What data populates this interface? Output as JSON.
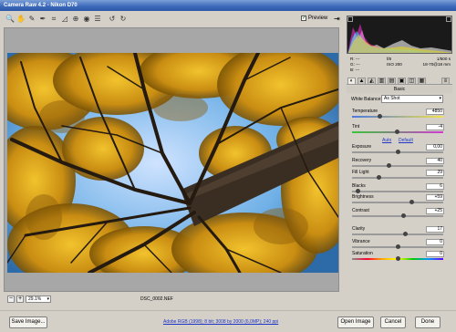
{
  "window": {
    "title": "Camera Raw 4.2  -  Nikon D70"
  },
  "toolbar": {
    "tools": [
      {
        "name": "zoom-tool-icon",
        "glyph": "🔍"
      },
      {
        "name": "hand-tool-icon",
        "glyph": "✋"
      },
      {
        "name": "white-balance-tool-icon",
        "glyph": "✎"
      },
      {
        "name": "color-sampler-tool-icon",
        "glyph": "✒"
      },
      {
        "name": "crop-tool-icon",
        "glyph": "⌗"
      },
      {
        "name": "straighten-tool-icon",
        "glyph": "◿"
      },
      {
        "name": "retouch-tool-icon",
        "glyph": "⊕"
      },
      {
        "name": "red-eye-tool-icon",
        "glyph": "◉"
      },
      {
        "name": "preferences-icon",
        "glyph": "☰"
      },
      {
        "name": "rotate-left-icon",
        "glyph": "↺"
      },
      {
        "name": "rotate-right-icon",
        "glyph": "↻"
      }
    ],
    "preview_label": "Preview",
    "preview_checked": true
  },
  "status": {
    "zoom": "29.1%",
    "filename": "DSC_0002.NEF"
  },
  "camera_info": {
    "r_label": "R:",
    "g_label": "G:",
    "b_label": "B:",
    "r": "---",
    "g": "---",
    "b": "---",
    "aperture": "f/8",
    "shutter": "1/500 s",
    "iso": "ISO 200",
    "lens": "18-70@18 mm"
  },
  "panel": {
    "title": "Basic",
    "white_balance_label": "White Balance:",
    "white_balance_value": "As Shot",
    "auto_label": "Auto",
    "default_label": "Default",
    "sliders": [
      {
        "label": "Temperature",
        "value": "4850",
        "fraction": 0.3
      },
      {
        "label": "Tint",
        "value": "-4",
        "fraction": 0.49
      },
      {
        "label": "Exposure",
        "value": "0,00",
        "fraction": 0.5
      },
      {
        "label": "Recovery",
        "value": "40",
        "fraction": 0.4
      },
      {
        "label": "Fill Light",
        "value": "29",
        "fraction": 0.29
      },
      {
        "label": "Blacks",
        "value": "6",
        "fraction": 0.06
      },
      {
        "label": "Brightness",
        "value": "+59",
        "fraction": 0.65
      },
      {
        "label": "Contrast",
        "value": "+25",
        "fraction": 0.56
      },
      {
        "label": "Clarity",
        "value": "17",
        "fraction": 0.58
      },
      {
        "label": "Vibrance",
        "value": "0",
        "fraction": 0.5
      },
      {
        "label": "Saturation",
        "value": "0",
        "fraction": 0.5
      }
    ]
  },
  "bottom": {
    "save_label": "Save Image...",
    "profile_link": "Adobe RGB (1998); 8 bit; 3008 by 2000 (6,0MP); 240 ppi",
    "open_label": "Open Image",
    "cancel_label": "Cancel",
    "done_label": "Done"
  },
  "colors": {
    "accent_link": "#1f35c8",
    "canvas_bg": "#a7a7a7",
    "panel_bg": "#d4d0c8"
  }
}
